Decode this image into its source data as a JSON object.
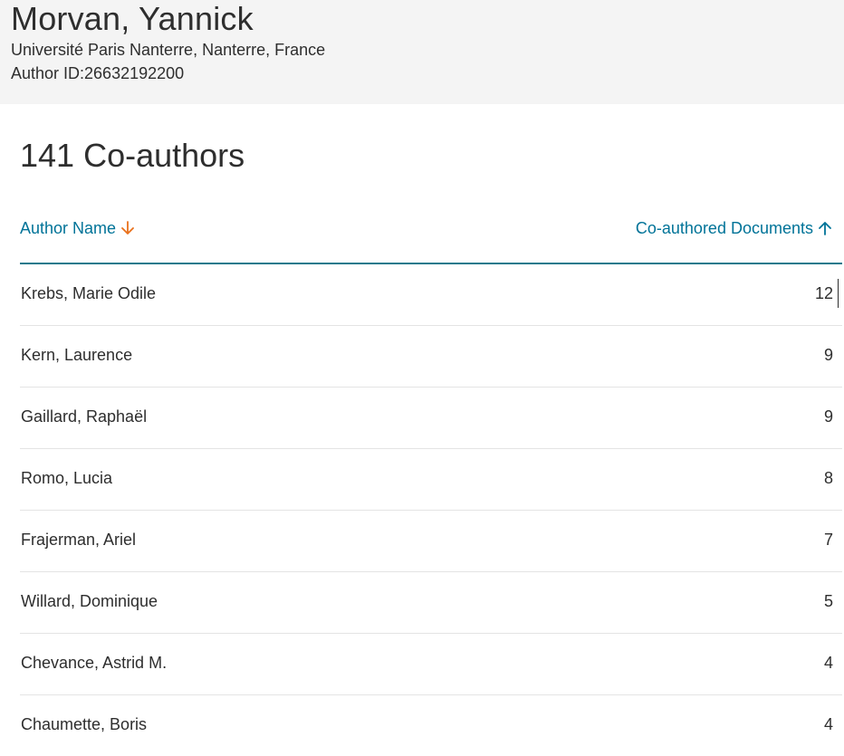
{
  "profile": {
    "name": "Morvan, Yannick",
    "affiliation": "Université Paris Nanterre, Nanterre, France",
    "author_id": "Author ID:26632192200"
  },
  "coauthors": {
    "title": "141 Co-authors",
    "columns": {
      "name": "Author Name",
      "documents": "Co-authored Documents"
    },
    "colors": {
      "link": "#007398",
      "sort_active": "#e9711c",
      "divider": "#1f7a8c"
    },
    "rows": [
      {
        "name": "Krebs, Marie Odile",
        "count": "12"
      },
      {
        "name": "Kern, Laurence",
        "count": "9"
      },
      {
        "name": "Gaillard, Raphaël",
        "count": "9"
      },
      {
        "name": "Romo, Lucia",
        "count": "8"
      },
      {
        "name": "Frajerman, Ariel",
        "count": "7"
      },
      {
        "name": "Willard, Dominique",
        "count": "5"
      },
      {
        "name": "Chevance, Astrid M.",
        "count": "4"
      },
      {
        "name": "Chaumette, Boris",
        "count": "4"
      }
    ]
  }
}
